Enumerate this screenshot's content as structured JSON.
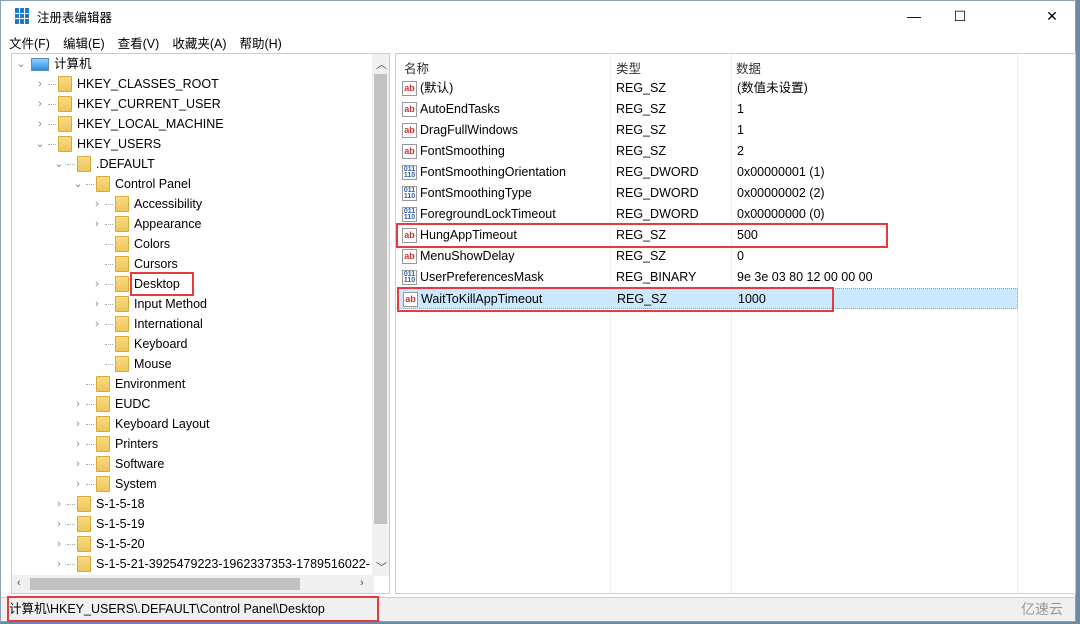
{
  "window": {
    "title": "注册表编辑器",
    "minimize": "—",
    "maximize": "☐",
    "close": "✕"
  },
  "menu": [
    "文件(F)",
    "编辑(E)",
    "查看(V)",
    "收藏夹(A)",
    "帮助(H)"
  ],
  "tree": [
    {
      "label": "计算机",
      "level": 0,
      "exp": "⌄",
      "icon": "computer"
    },
    {
      "label": "HKEY_CLASSES_ROOT",
      "level": 1,
      "exp": "›"
    },
    {
      "label": "HKEY_CURRENT_USER",
      "level": 1,
      "exp": "›"
    },
    {
      "label": "HKEY_LOCAL_MACHINE",
      "level": 1,
      "exp": "›"
    },
    {
      "label": "HKEY_USERS",
      "level": 1,
      "exp": "⌄"
    },
    {
      "label": ".DEFAULT",
      "level": 2,
      "exp": "⌄"
    },
    {
      "label": "Control Panel",
      "level": 3,
      "exp": "⌄"
    },
    {
      "label": "Accessibility",
      "level": 4,
      "exp": "›"
    },
    {
      "label": "Appearance",
      "level": 4,
      "exp": "›"
    },
    {
      "label": "Colors",
      "level": 4,
      "exp": ""
    },
    {
      "label": "Cursors",
      "level": 4,
      "exp": ""
    },
    {
      "label": "Desktop",
      "level": 4,
      "exp": "›",
      "selected": true
    },
    {
      "label": "Input Method",
      "level": 4,
      "exp": "›"
    },
    {
      "label": "International",
      "level": 4,
      "exp": "›"
    },
    {
      "label": "Keyboard",
      "level": 4,
      "exp": ""
    },
    {
      "label": "Mouse",
      "level": 4,
      "exp": ""
    },
    {
      "label": "Environment",
      "level": 3,
      "exp": ""
    },
    {
      "label": "EUDC",
      "level": 3,
      "exp": "›"
    },
    {
      "label": "Keyboard Layout",
      "level": 3,
      "exp": "›"
    },
    {
      "label": "Printers",
      "level": 3,
      "exp": "›"
    },
    {
      "label": "Software",
      "level": 3,
      "exp": "›"
    },
    {
      "label": "System",
      "level": 3,
      "exp": "›"
    },
    {
      "label": "S-1-5-18",
      "level": 2,
      "exp": "›"
    },
    {
      "label": "S-1-5-19",
      "level": 2,
      "exp": "›"
    },
    {
      "label": "S-1-5-20",
      "level": 2,
      "exp": "›"
    },
    {
      "label": "S-1-5-21-3925479223-1962337353-1789516022-",
      "level": 2,
      "exp": "›"
    }
  ],
  "columns": [
    "名称",
    "类型",
    "数据"
  ],
  "values": [
    {
      "name": "(默认)",
      "type": "REG_SZ",
      "data": "(数值未设置)",
      "icon": "string"
    },
    {
      "name": "AutoEndTasks",
      "type": "REG_SZ",
      "data": "1",
      "icon": "string"
    },
    {
      "name": "DragFullWindows",
      "type": "REG_SZ",
      "data": "1",
      "icon": "string"
    },
    {
      "name": "FontSmoothing",
      "type": "REG_SZ",
      "data": "2",
      "icon": "string"
    },
    {
      "name": "FontSmoothingOrientation",
      "type": "REG_DWORD",
      "data": "0x00000001 (1)",
      "icon": "binary"
    },
    {
      "name": "FontSmoothingType",
      "type": "REG_DWORD",
      "data": "0x00000002 (2)",
      "icon": "binary"
    },
    {
      "name": "ForegroundLockTimeout",
      "type": "REG_DWORD",
      "data": "0x00000000 (0)",
      "icon": "binary"
    },
    {
      "name": "HungAppTimeout",
      "type": "REG_SZ",
      "data": "500",
      "icon": "string",
      "highlighted": true
    },
    {
      "name": "MenuShowDelay",
      "type": "REG_SZ",
      "data": "0",
      "icon": "string"
    },
    {
      "name": "UserPreferencesMask",
      "type": "REG_BINARY",
      "data": "9e 3e 03 80 12 00 00 00",
      "icon": "binary"
    },
    {
      "name": "WaitToKillAppTimeout",
      "type": "REG_SZ",
      "data": "1000",
      "icon": "string",
      "highlighted": true,
      "selected": true
    }
  ],
  "status": "计算机\\HKEY_USERS\\.DEFAULT\\Control Panel\\Desktop",
  "watermark": "亿速云",
  "colors": {
    "highlight": "#e53a40",
    "selection": "#cce8ff"
  }
}
